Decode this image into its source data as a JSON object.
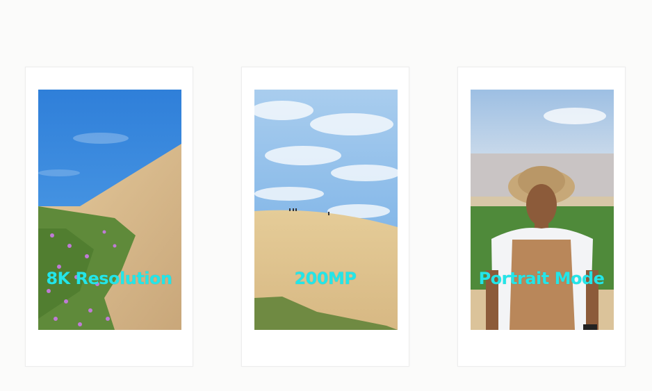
{
  "cards": [
    {
      "caption": "8K Resolution",
      "scene": "sand-dune-with-flowers"
    },
    {
      "caption": "200MP",
      "scene": "sand-dune-with-people"
    },
    {
      "caption": "Portrait Mode",
      "scene": "portrait-at-beach"
    }
  ],
  "colors": {
    "caption": "#24e5e8",
    "sky": "#3a86da",
    "sand": "#dcc092",
    "background": "#fbfbfa"
  }
}
